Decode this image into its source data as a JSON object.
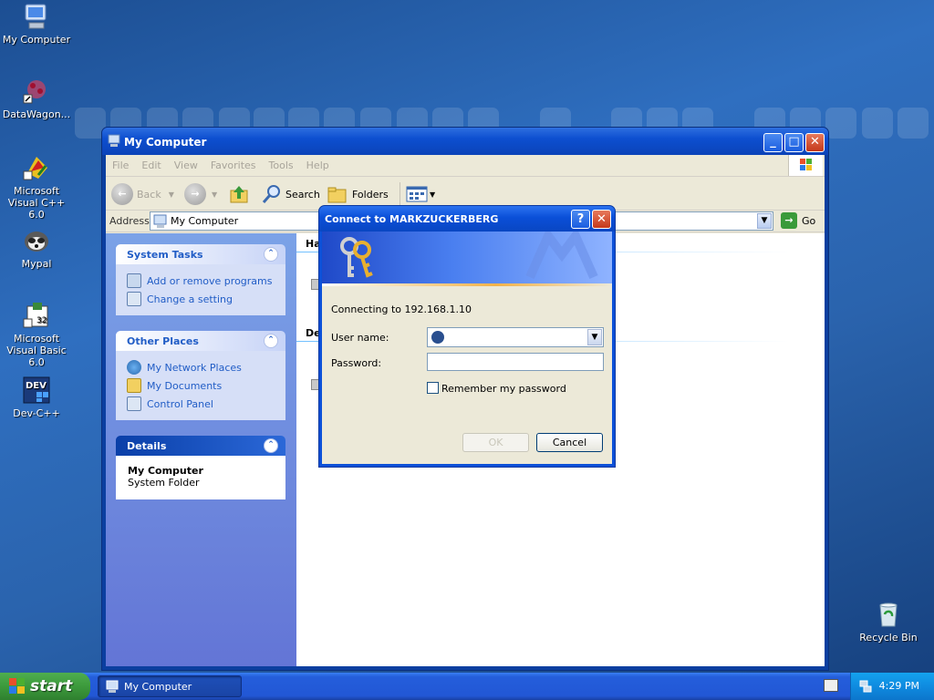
{
  "desktop": {
    "icons": [
      {
        "label": "My Computer"
      },
      {
        "label": "DataWagon..."
      },
      {
        "label": "Microsoft Visual C++ 6.0"
      },
      {
        "label": "Mypal"
      },
      {
        "label": "Microsoft Visual Basic 6.0"
      },
      {
        "label": "Dev-C++"
      },
      {
        "label": "Recycle Bin"
      }
    ]
  },
  "window": {
    "title": "My Computer",
    "menu": [
      "File",
      "Edit",
      "View",
      "Favorites",
      "Tools",
      "Help"
    ],
    "toolbar": {
      "back": "Back",
      "search": "Search",
      "folders": "Folders"
    },
    "address": {
      "label": "Address",
      "value": "My Computer",
      "go": "Go"
    },
    "left_panels": [
      {
        "title": "System Tasks",
        "links": [
          "Add or remove programs",
          "Change a setting"
        ]
      },
      {
        "title": "Other Places",
        "links": [
          "My Network Places",
          "My Documents",
          "Control Panel"
        ]
      },
      {
        "title": "Details",
        "name": "My Computer",
        "desc": "System Folder"
      }
    ],
    "sections": [
      "Ha",
      "De"
    ]
  },
  "dialog": {
    "title": "Connect to MARKZUCKERBERG",
    "connecting": "Connecting to 192.168.1.10",
    "username_label": "User name:",
    "password_label": "Password:",
    "remember_label": "Remember my password",
    "ok": "OK",
    "cancel": "Cancel"
  },
  "taskbar": {
    "start": "start",
    "task": "My Computer",
    "clock": "4:29 PM"
  },
  "colors": {
    "titlebar": "#0b4fd0",
    "link": "#215dc6",
    "start": "#3c9a3c"
  }
}
